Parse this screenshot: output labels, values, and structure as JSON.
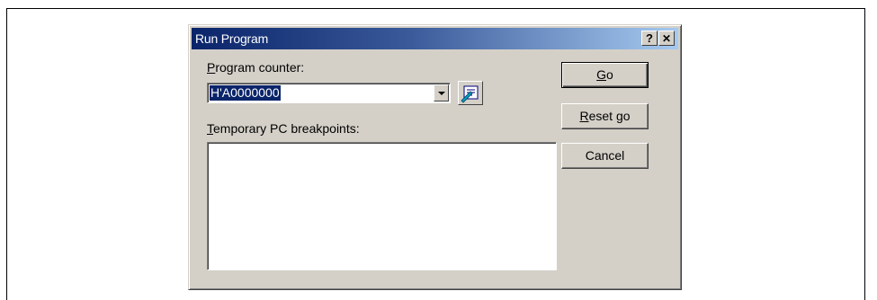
{
  "dialog": {
    "title": "Run Program",
    "help_button": "?",
    "close_button": "✕"
  },
  "program_counter": {
    "label_accel": "P",
    "label_rest": "rogram counter:",
    "value": "H'A0000000"
  },
  "breakpoints": {
    "label_accel": "T",
    "label_rest": "emporary PC breakpoints:",
    "items": []
  },
  "buttons": {
    "go_accel": "G",
    "go_rest": "o",
    "reset_accel": "R",
    "reset_rest": "eset go",
    "cancel": "Cancel"
  },
  "icons": {
    "help": "help-icon",
    "close": "close-icon",
    "dropdown": "chevron-down-icon",
    "pc_pick": "pc-select-icon"
  }
}
